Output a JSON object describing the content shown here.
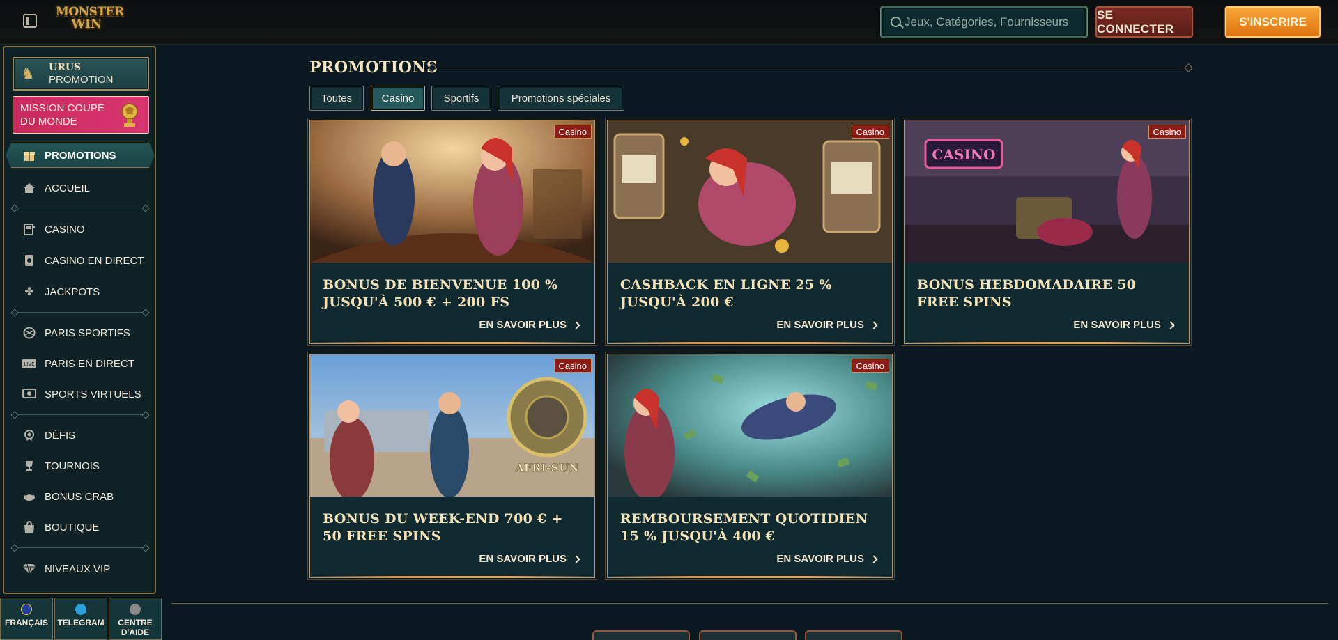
{
  "header": {
    "logo_line1": "MONSTER",
    "logo_line2": "WIN",
    "search_placeholder": "Jeux, Catégories, Fournisseurs",
    "login_label": "SE CONNECTER",
    "register_label": "S'INSCRIRE"
  },
  "sidebar": {
    "urus_title": "URUS",
    "urus_sub": "PROMOTION",
    "mission_label": "MISSION COUPE DU MONDE",
    "items": [
      {
        "label": "PROMOTIONS",
        "icon": "gift-icon"
      },
      {
        "label": "ACCUEIL",
        "icon": "home-icon"
      },
      {
        "label": "CASINO",
        "icon": "slot-machine-icon"
      },
      {
        "label": "CASINO EN DIRECT",
        "icon": "cards-icon"
      },
      {
        "label": "JACKPOTS",
        "icon": "clover-icon"
      },
      {
        "label": "PARIS SPORTIFS",
        "icon": "ball-icon"
      },
      {
        "label": "PARIS EN DIRECT",
        "icon": "live-icon"
      },
      {
        "label": "SPORTS VIRTUELS",
        "icon": "virtual-icon"
      },
      {
        "label": "DÉFIS",
        "icon": "medal-icon"
      },
      {
        "label": "TOURNOIS",
        "icon": "trophy-icon"
      },
      {
        "label": "BONUS CRAB",
        "icon": "crab-icon"
      },
      {
        "label": "BOUTIQUE",
        "icon": "bag-icon"
      },
      {
        "label": "NIVEAUX VIP",
        "icon": "diamond-icon"
      }
    ],
    "footer": {
      "language": "FRANÇAIS",
      "telegram": "TELEGRAM",
      "help_line1": "CENTRE",
      "help_line2": "D'AIDE"
    }
  },
  "main": {
    "title": "PROMOTIONS",
    "tabs": [
      "Toutes",
      "Casino",
      "Sportifs",
      "Promotions spéciales"
    ],
    "active_tab": "Casino",
    "cards": [
      {
        "badge": "Casino",
        "title": "BONUS DE BIENVENUE 100 % JUSQU'À 500 € + 200 FS",
        "link": "EN SAVOIR PLUS"
      },
      {
        "badge": "Casino",
        "title": "CASHBACK EN LIGNE 25 % JUSQU'À 200 €",
        "link": "EN SAVOIR PLUS"
      },
      {
        "badge": "Casino",
        "title": "BONUS HEBDOMADAIRE 50 FREE SPINS",
        "link": "EN SAVOIR PLUS"
      },
      {
        "badge": "Casino",
        "title": "BONUS DU WEEK-END 700 € + 50 FREE SPINS",
        "link": "EN SAVOIR PLUS"
      },
      {
        "badge": "Casino",
        "title": "REMBOURSEMENT QUOTIDIEN 15 % JUSQU'À 400 €",
        "link": "EN SAVOIR PLUS"
      }
    ],
    "card3_sign": "CASINO",
    "card4_sign": "AFRI-SUN"
  },
  "colors": {
    "background": "#0a1a20",
    "accent_gold": "#d4a544",
    "register_orange": "#f5a637",
    "login_red": "#7a2b22",
    "badge_red": "#8a1d16"
  }
}
